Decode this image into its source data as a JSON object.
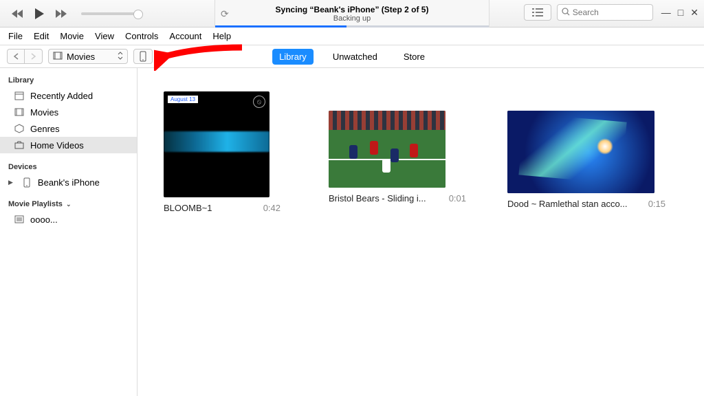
{
  "player": {
    "lcd_title": "Syncing “Beank's iPhone” (Step 2 of 5)",
    "lcd_subtitle": "Backing up",
    "search_placeholder": "Search"
  },
  "menu": {
    "items": [
      "File",
      "Edit",
      "Movie",
      "View",
      "Controls",
      "Account",
      "Help"
    ]
  },
  "toolbar": {
    "category_label": "Movies",
    "tabs": {
      "library": "Library",
      "unwatched": "Unwatched",
      "store": "Store"
    }
  },
  "sidebar": {
    "library_header": "Library",
    "library_items": [
      {
        "label": "Recently Added",
        "icon": "calendar"
      },
      {
        "label": "Movies",
        "icon": "film"
      },
      {
        "label": "Genres",
        "icon": "genres"
      },
      {
        "label": "Home Videos",
        "icon": "home-video",
        "selected": true
      }
    ],
    "devices_header": "Devices",
    "devices": [
      {
        "label": "Beank's iPhone"
      }
    ],
    "playlists_header": "Movie Playlists",
    "playlists": [
      {
        "label": "oooo..."
      }
    ]
  },
  "videos": [
    {
      "title": "BLOOMB~1",
      "duration": "0:42",
      "badge": "August  13"
    },
    {
      "title": "Bristol Bears - Sliding i...",
      "duration": "0:01"
    },
    {
      "title": "Dood ~ Ramlethal stan acco...",
      "duration": "0:15"
    }
  ]
}
